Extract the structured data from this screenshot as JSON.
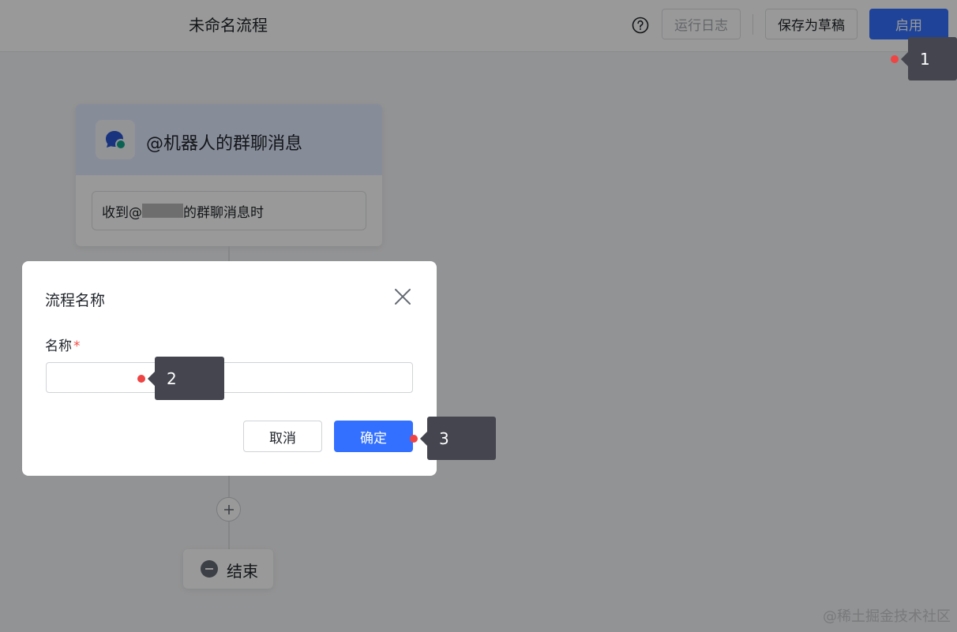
{
  "header": {
    "flow_title": "未命名流程",
    "log_label": "运行日志",
    "draft_label": "保存为草稿",
    "enable_label": "启用"
  },
  "canvas": {
    "trigger": {
      "title": "@机器人的群聊消息",
      "condition_prefix": "收到@",
      "condition_suffix": "的群聊消息时"
    },
    "end_label": "结束"
  },
  "dialog": {
    "title": "流程名称",
    "field_label": "名称",
    "required_mark": "*",
    "input_value": "",
    "input_placeholder": "",
    "cancel_label": "取消",
    "confirm_label": "确定"
  },
  "annotations": [
    "1",
    "2",
    "3"
  ],
  "watermark": "@稀土掘金技术社区",
  "colors": {
    "primary": "#3370ff",
    "annotation_dot": "#ef4444",
    "annotation_tag": "#44454f",
    "trigger_header": "#e1eaff"
  },
  "icons": {
    "help": "help-circle-icon",
    "close": "close-icon",
    "trigger": "chat-bubble-icon",
    "add": "plus-icon",
    "end": "minus-circle-icon"
  }
}
